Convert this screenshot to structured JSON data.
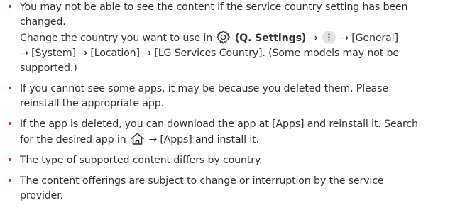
{
  "bullets": [
    {
      "line1": "You may not be able to see the content if the service country setting has been",
      "line2": "changed.",
      "line3_prefix": "Change the country you want to use in",
      "line3_bold": "(Q. Settings)",
      "line3_arrow1": "→",
      "line3_arrow2": "→ [General]",
      "line4": "→ [System] → [Location] → [LG Services Country]. (Some models may not be",
      "line5": "supported.)"
    },
    {
      "line1": "If you cannot see some apps, it may be because you deleted them. Please",
      "line2": "reinstall the appropriate app."
    },
    {
      "line1": "If the app is deleted, you can download the app at [Apps] and reinstall it. Search",
      "line2_prefix": "for the desired app in",
      "line2_suffix": "→ [Apps] and install it."
    },
    {
      "line1": "The type of supported content differs by country."
    },
    {
      "line1": "The content offerings are subject to change or interruption by the service",
      "line2": "provider."
    }
  ],
  "bullet_symbol": "•",
  "icons": {
    "settings": "gear-icon",
    "more": "more-options-icon",
    "home": "home-icon"
  },
  "colors": {
    "bullet": "#c8254b",
    "text": "#333333"
  }
}
